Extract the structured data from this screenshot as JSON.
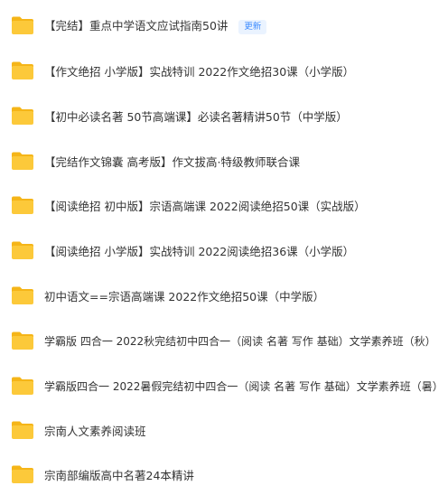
{
  "file_list": {
    "items": [
      {
        "name": "【完结】重点中学语文应试指南50讲",
        "badge": "更新",
        "icon": "folder-icon"
      },
      {
        "name": "【作文绝招 小学版】实战特训 2022作文绝招30课（小学版）",
        "icon": "folder-icon"
      },
      {
        "name": "【初中必读名著 50节高端课】必读名著精讲50节（中学版）",
        "icon": "folder-icon"
      },
      {
        "name": "【完结作文锦囊 高考版】作文拔高·特级教师联合课",
        "icon": "folder-icon"
      },
      {
        "name": "【阅读绝招 初中版】宗语高端课 2022阅读绝招50课（实战版）",
        "icon": "folder-icon"
      },
      {
        "name": "【阅读绝招 小学版】实战特训 2022阅读绝招36课（小学版）",
        "icon": "folder-icon"
      },
      {
        "name": "初中语文==宗语高端课 2022作文绝招50课（中学版）",
        "icon": "folder-icon"
      },
      {
        "name": "学霸版 四合一 2022秋完结初中四合一（阅读 名著 写作 基础）文学素养班（秋）",
        "icon": "folder-icon"
      },
      {
        "name": "学霸版四合一 2022暑假完结初中四合一（阅读 名著 写作 基础）文学素养班（暑）",
        "icon": "folder-icon"
      },
      {
        "name": "宗南人文素养阅读班",
        "icon": "folder-icon"
      },
      {
        "name": "宗南部编版高中名著24本精讲",
        "icon": "folder-icon"
      }
    ]
  },
  "colors": {
    "folder_body": "#fcc93a",
    "folder_tab": "#f5b518",
    "text": "#333333",
    "badge_text": "#3f8cff",
    "badge_bg": "#eaf3ff"
  }
}
